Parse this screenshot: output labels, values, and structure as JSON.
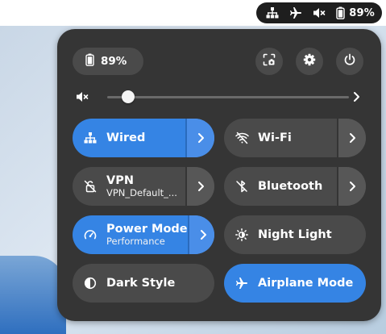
{
  "top_bar": {
    "indicators": [
      "network-wired-icon",
      "airplane-icon",
      "volume-muted-icon",
      "battery-icon"
    ],
    "battery_percent": "89%"
  },
  "quick_settings": {
    "battery": {
      "icon": "battery-icon",
      "label": "89%"
    },
    "header_buttons": [
      {
        "name": "screenshot-button",
        "icon": "screenshot-icon"
      },
      {
        "name": "settings-button",
        "icon": "gear-icon"
      },
      {
        "name": "power-button",
        "icon": "power-icon"
      }
    ],
    "volume": {
      "icon": "volume-muted-icon",
      "level": 0.0
    },
    "toggles": [
      {
        "title": "Wired",
        "subtitle": "",
        "icon": "network-wired-icon",
        "active": true,
        "has_menu": true
      },
      {
        "title": "Wi-Fi",
        "subtitle": "",
        "icon": "wifi-disabled-icon",
        "active": false,
        "has_menu": true
      },
      {
        "title": "VPN",
        "subtitle": "VPN_Default_...",
        "icon": "vpn-disabled-icon",
        "active": false,
        "has_menu": true
      },
      {
        "title": "Bluetooth",
        "subtitle": "",
        "icon": "bluetooth-disabled-icon",
        "active": false,
        "has_menu": true
      },
      {
        "title": "Power Mode",
        "subtitle": "Performance",
        "icon": "power-mode-icon",
        "active": true,
        "has_menu": true
      },
      {
        "title": "Night Light",
        "subtitle": "",
        "icon": "night-light-icon",
        "active": false,
        "has_menu": false
      },
      {
        "title": "Dark Style",
        "subtitle": "",
        "icon": "dark-style-icon",
        "active": false,
        "has_menu": false
      },
      {
        "title": "Airplane Mode",
        "subtitle": "",
        "icon": "airplane-icon",
        "active": true,
        "has_menu": false
      }
    ]
  },
  "colors": {
    "panel_bg": "#353535",
    "tile_bg": "#4a4a4a",
    "accent": "#3584e4",
    "topbar_pill": "#1e1e1e"
  }
}
